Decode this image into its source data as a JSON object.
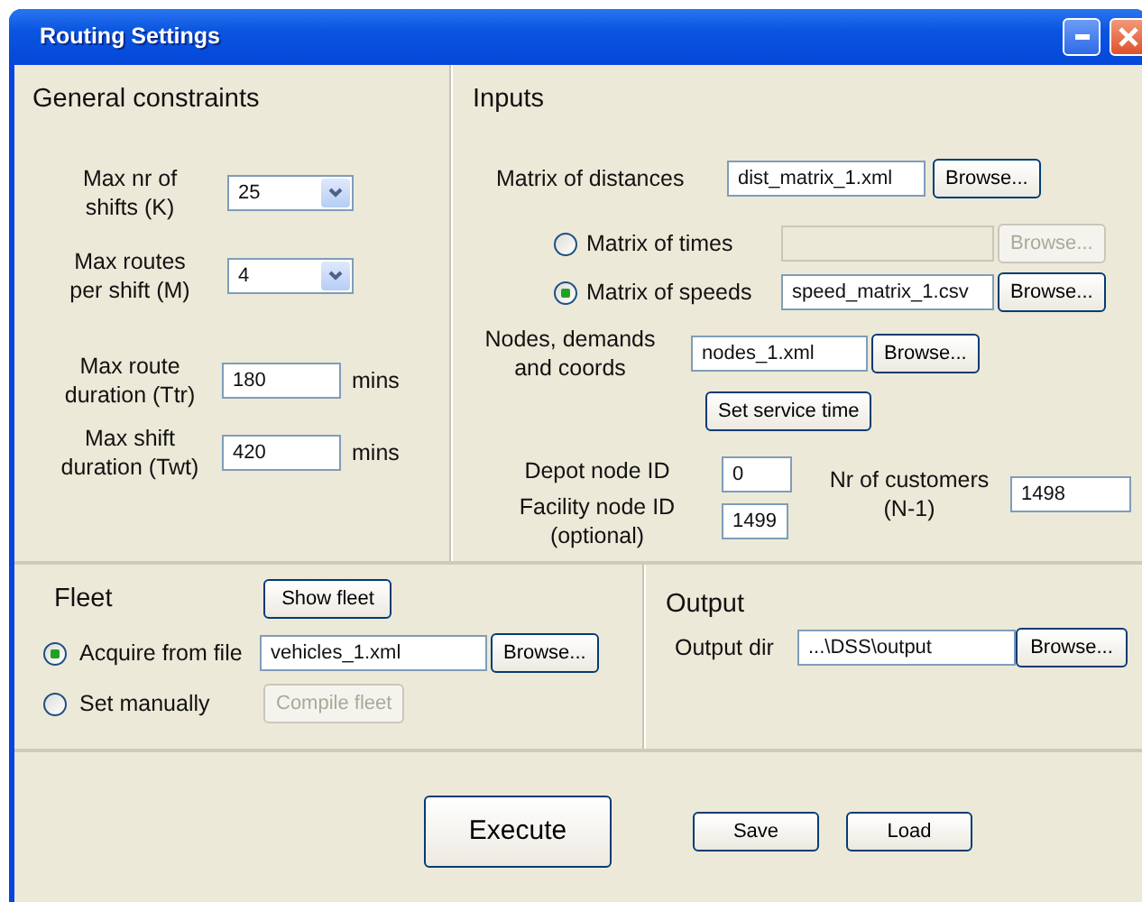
{
  "window": {
    "title": "Routing Settings"
  },
  "general_constraints": {
    "title": "General constraints",
    "fields": [
      {
        "kind": "select",
        "label": "Max nr of\nshifts (K)",
        "value": "25"
      },
      {
        "kind": "select",
        "label": "Max routes\nper shift (M)",
        "value": "4"
      },
      {
        "kind": "text",
        "label": "Max route\nduration (Ttr)",
        "value": "180",
        "unit": "mins"
      },
      {
        "kind": "text",
        "label": "Max shift\nduration (Twt)",
        "value": "420",
        "unit": "mins"
      }
    ]
  },
  "inputs": {
    "title": "Inputs",
    "distances": {
      "label": "Matrix of distances",
      "value": "dist_matrix_1.xml",
      "button": "Browse..."
    },
    "matrix_options": [
      {
        "label": "Matrix of times",
        "selected": false,
        "button": "Browse...",
        "disabled": true
      },
      {
        "label": "Matrix of speeds",
        "selected": true,
        "value": "speed_matrix_1.csv",
        "button": "Browse...",
        "disabled": false
      }
    ],
    "nodes": {
      "label": "Nodes, demands\nand coords",
      "value": "nodes_1.xml",
      "button": "Browse...",
      "service_button": "Set service time"
    },
    "depot": {
      "label": "Depot node ID",
      "value": "0"
    },
    "facility": {
      "label": "Facility node ID\n(optional)",
      "value": "1499"
    },
    "customers": {
      "label": "Nr of customers\n(N-1)",
      "value": "1498"
    }
  },
  "fleet": {
    "title": "Fleet",
    "show_button": "Show fleet",
    "options": [
      {
        "label": "Acquire from file",
        "selected": true,
        "value": "vehicles_1.xml",
        "button": "Browse...",
        "disabled": false
      },
      {
        "label": "Set manually",
        "selected": false,
        "button": "Compile fleet",
        "disabled": true
      }
    ]
  },
  "output": {
    "title": "Output",
    "label": "Output dir",
    "value": "...\\DSS\\output",
    "button": "Browse..."
  },
  "actions": {
    "execute": "Execute",
    "save": "Save",
    "load": "Load"
  }
}
